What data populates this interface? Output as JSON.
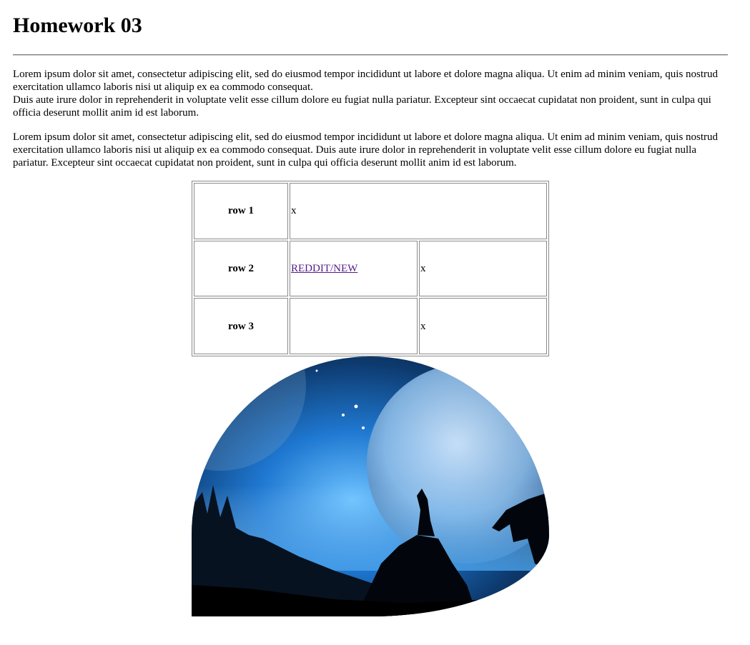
{
  "title": "Homework 03",
  "paragraphs": {
    "p1_line1": "Lorem ipsum dolor sit amet, consectetur adipiscing elit, sed do eiusmod tempor incididunt ut labore et dolore magna aliqua. Ut enim ad minim veniam, quis nostrud exercitation ullamco laboris nisi ut aliquip ex ea commodo consequat.",
    "p1_line2": "Duis aute irure dolor in reprehenderit in voluptate velit esse cillum dolore eu fugiat nulla pariatur. Excepteur sint occaecat cupidatat non proident, sunt in culpa qui officia deserunt mollit anim id est laborum.",
    "p2": "Lorem ipsum dolor sit amet, consectetur adipiscing elit, sed do eiusmod tempor incididunt ut labore et dolore magna aliqua. Ut enim ad minim veniam, quis nostrud exercitation ullamco laboris nisi ut aliquip ex ea commodo consequat. Duis aute irure dolor in reprehenderit in voluptate velit esse cillum dolore eu fugiat nulla pariatur. Excepteur sint occaecat cupidatat non proident, sunt in culpa qui officia deserunt mollit anim id est laborum."
  },
  "table": {
    "rows": [
      {
        "header": "row 1",
        "cell": "x"
      },
      {
        "header": "row 2",
        "link": "REDDIT/NEW",
        "cell": "x"
      },
      {
        "header": "row 3",
        "cell": "x"
      }
    ]
  },
  "image": {
    "subject": "howling wolf under moon",
    "icon": "wolf-moon-image"
  },
  "colors": {
    "link_visited": "#551a8b",
    "border": "#8a8a8a",
    "sky_blue": "#1f78d1",
    "night": "#0a1420"
  }
}
